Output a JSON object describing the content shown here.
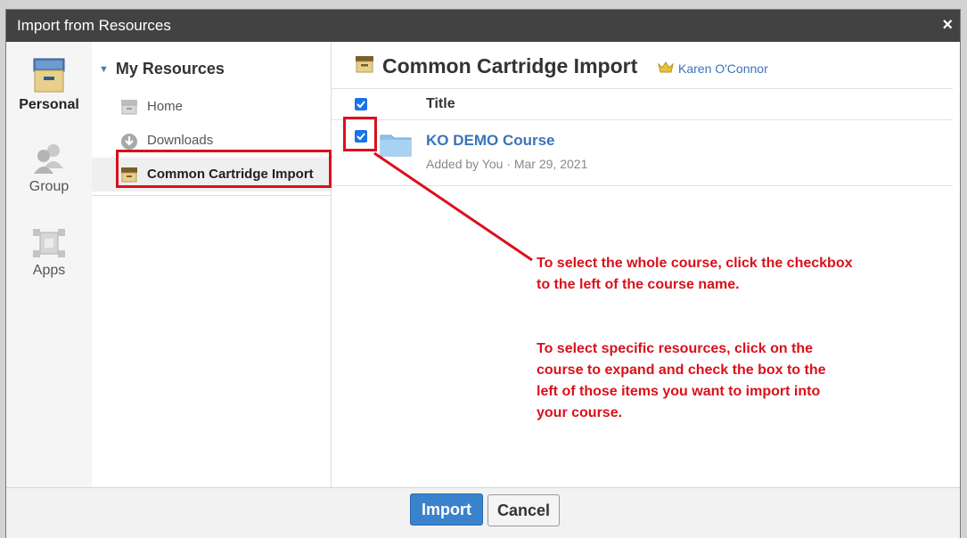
{
  "dialog": {
    "title": "Import from Resources",
    "close_label": "×"
  },
  "rail": {
    "items": [
      {
        "label": "Personal",
        "icon": "archive-box-icon"
      },
      {
        "label": "Group",
        "icon": "group-people-icon"
      },
      {
        "label": "Apps",
        "icon": "apps-icon"
      }
    ]
  },
  "tree": {
    "header": "My Resources",
    "items": [
      {
        "label": "Home",
        "icon": "archive-box-icon"
      },
      {
        "label": "Downloads",
        "icon": "download-icon"
      },
      {
        "label": "Common Cartridge Import",
        "icon": "archive-box-icon"
      }
    ]
  },
  "main": {
    "title": "Common Cartridge Import",
    "owner": "Karen O'Connor",
    "column_title": "Title",
    "rows": [
      {
        "name": "KO DEMO Course",
        "meta": "Added by You · Mar 29, 2021",
        "checked": true
      }
    ]
  },
  "annotations": {
    "note1": "To select the whole course, click the checkbox to the left of the course name.",
    "note2": "To select specific resources, click on the course to expand and check the box to the left of those items you want to import into your course."
  },
  "footer": {
    "import_label": "Import",
    "cancel_label": "Cancel"
  },
  "colors": {
    "accent": "#3a82cc",
    "annotation": "#d9111b",
    "titlebar": "#424242"
  }
}
